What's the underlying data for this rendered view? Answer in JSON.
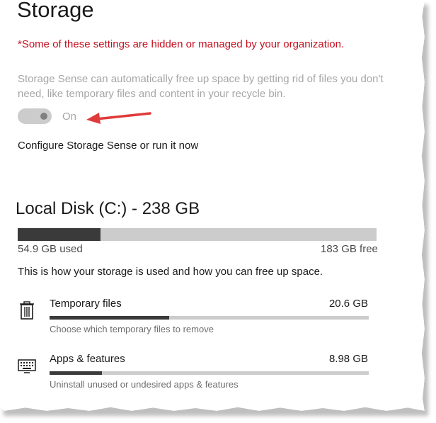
{
  "page": {
    "title": "Storage",
    "managed_notice": "*Some of these settings are hidden or managed by your organization.",
    "storage_sense": {
      "description": "Storage Sense can automatically free up space by getting rid of files you don't need, like temporary files and content in your recycle bin.",
      "toggle_state": "On",
      "configure_link": "Configure Storage Sense or run it now"
    },
    "local_disk": {
      "title": "Local Disk (C:) - 238 GB",
      "used_label": "54.9 GB used",
      "free_label": "183 GB free",
      "used_fraction": 0.23
    },
    "usage_info": "This is how your storage is used and how you can free up space.",
    "categories": [
      {
        "icon": "trash-icon",
        "name": "Temporary files",
        "size": "20.6 GB",
        "fraction": 0.375,
        "description": "Choose which temporary files to remove"
      },
      {
        "icon": "keyboard-icon",
        "name": "Apps & features",
        "size": "8.98 GB",
        "fraction": 0.165,
        "description": "Uninstall unused or undesired apps & features"
      }
    ]
  },
  "colors": {
    "warning_red": "#c50f1f",
    "annotation_arrow": "#e03a3a",
    "bar_fill": "#3a3a3a",
    "bar_track": "#cccccc",
    "disabled_text": "#a6a6a6"
  }
}
